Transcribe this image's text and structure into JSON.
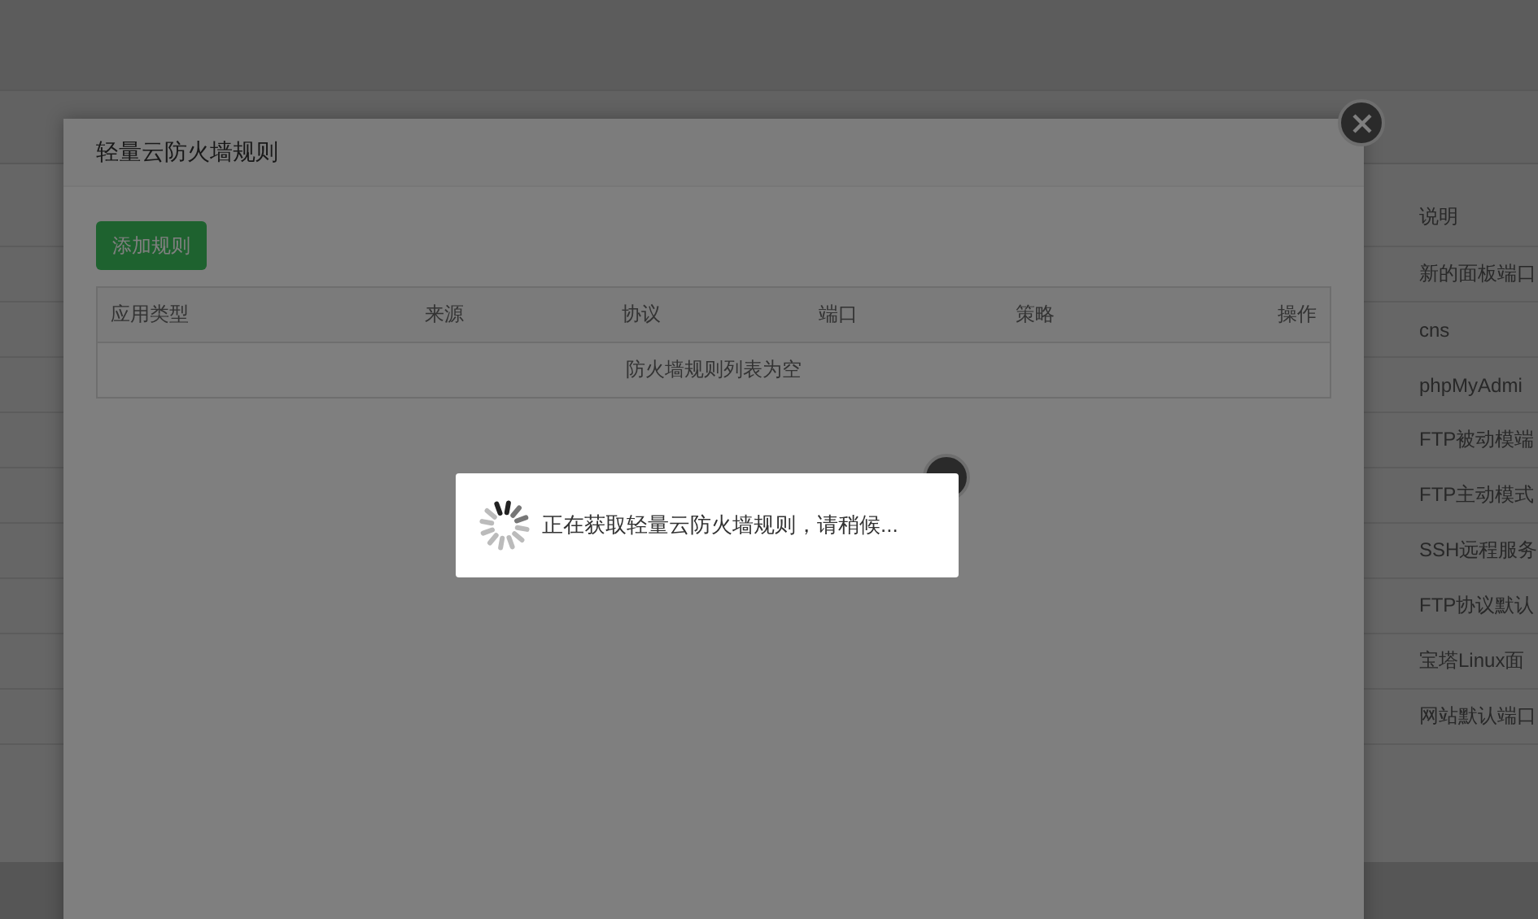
{
  "background_table": {
    "column_heading": "说明",
    "rows": [
      "新的面板端口",
      "cns",
      "phpMyAdmi",
      "FTP被动模端",
      "FTP主动模式",
      "SSH远程服务",
      "FTP协议默认",
      "宝塔Linux面",
      "网站默认端口"
    ]
  },
  "dialog": {
    "title": "轻量云防火墙规则",
    "add_button": "添加规则",
    "table": {
      "columns": [
        "应用类型",
        "来源",
        "协议",
        "端口",
        "策略",
        "操作"
      ],
      "empty_message": "防火墙规则列表为空"
    }
  },
  "loading": {
    "message": "正在获取轻量云防火墙规则，请稍候..."
  }
}
